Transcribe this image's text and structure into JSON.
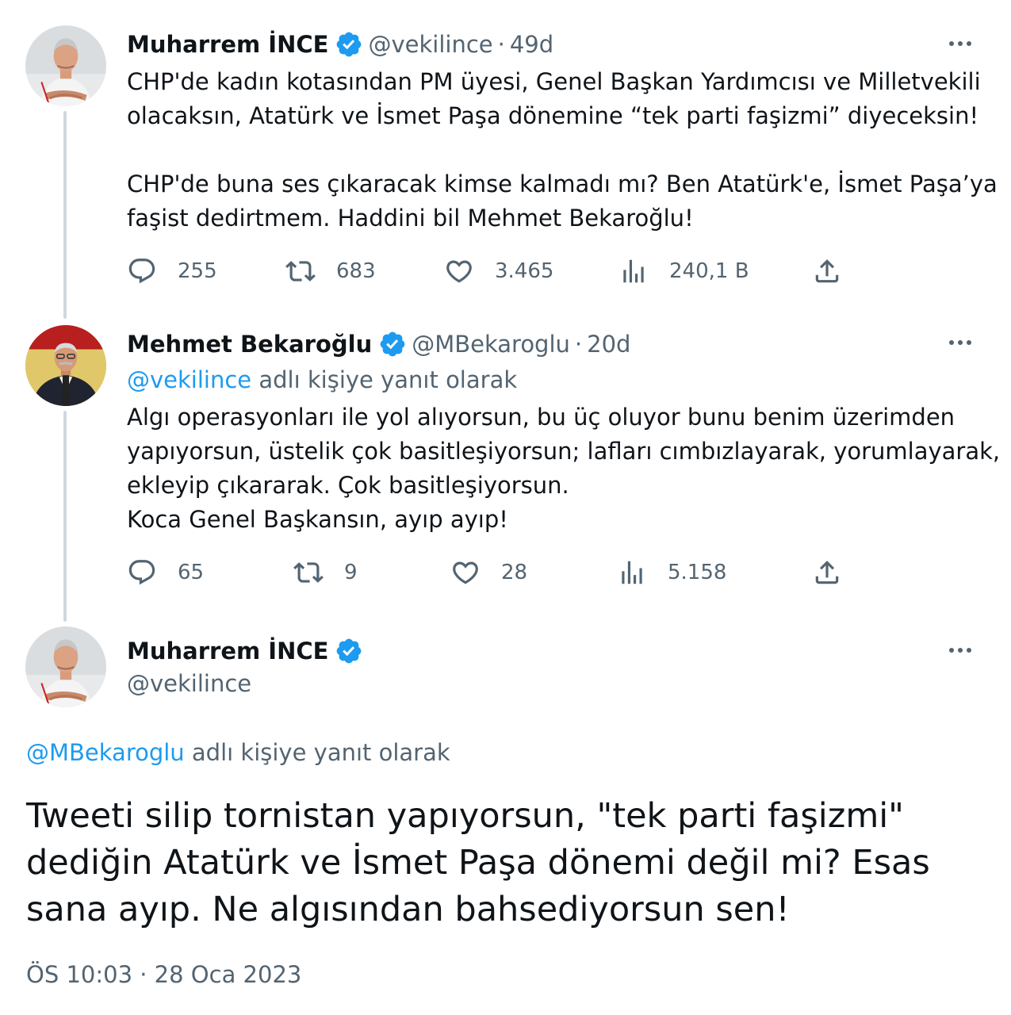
{
  "tweets": [
    {
      "author": "Muharrem İNCE",
      "handle": "@vekilince",
      "time": "49d",
      "text_lines": [
        "CHP'de kadın kotasından PM üyesi, Genel Başkan Yardımcısı ve Milletvekili",
        "olacaksın, Atatürk ve İsmet Paşa dönemine “tek parti faşizmi” diyeceksin!",
        "CHP'de buna ses çıkaracak kimse kalmadı mı? Ben Atatürk'e, İsmet Paşa’ya",
        "faşist dedirtmem. Haddini bil Mehmet Bekaroğlu!"
      ],
      "stats": {
        "replies": "255",
        "retweets": "683",
        "likes": "3.465",
        "views": "240,1 B"
      }
    },
    {
      "author": "Mehmet Bekaroğlu",
      "handle": "@MBekaroglu",
      "time": "20d",
      "reply_mention": "@vekilince",
      "reply_suffix": "adlı kişiye yanıt olarak",
      "text_lines": [
        "Algı operasyonları ile yol alıyorsun, bu üç oluyor bunu benim üzerimden",
        "yapıyorsun, üstelik çok basitleşiyorsun; lafları cımbızlayarak, yorumlayarak,",
        "ekleyip çıkararak. Çok basitleşiyorsun.",
        "Koca Genel Başkansın, ayıp ayıp!"
      ],
      "stats": {
        "replies": "65",
        "retweets": "9",
        "likes": "28",
        "views": "5.158"
      }
    }
  ],
  "main_tweet": {
    "author": "Muharrem İNCE",
    "handle": "@vekilince",
    "reply_mention": "@MBekaroglu",
    "reply_suffix": "adlı kişiye yanıt olarak",
    "text_lines": [
      "Tweeti silip tornistan yapıyorsun, \"tek parti faşizmi\"",
      "dediğin Atatürk ve İsmet Paşa dönemi değil mi? Esas",
      "sana ayıp. Ne algısından bahsediyorsun sen!"
    ],
    "timestamp": "ÖS 10:03 · 28 Oca 2023"
  },
  "ui": {
    "separator": "·",
    "icons": [
      "verified-badge-icon",
      "more-options-icon",
      "reply-icon",
      "retweet-icon",
      "like-icon",
      "views-icon",
      "share-icon"
    ],
    "colors": {
      "accent": "#1d9bf0",
      "secondary_text": "#536471",
      "thread_line": "#cfd9de"
    }
  }
}
